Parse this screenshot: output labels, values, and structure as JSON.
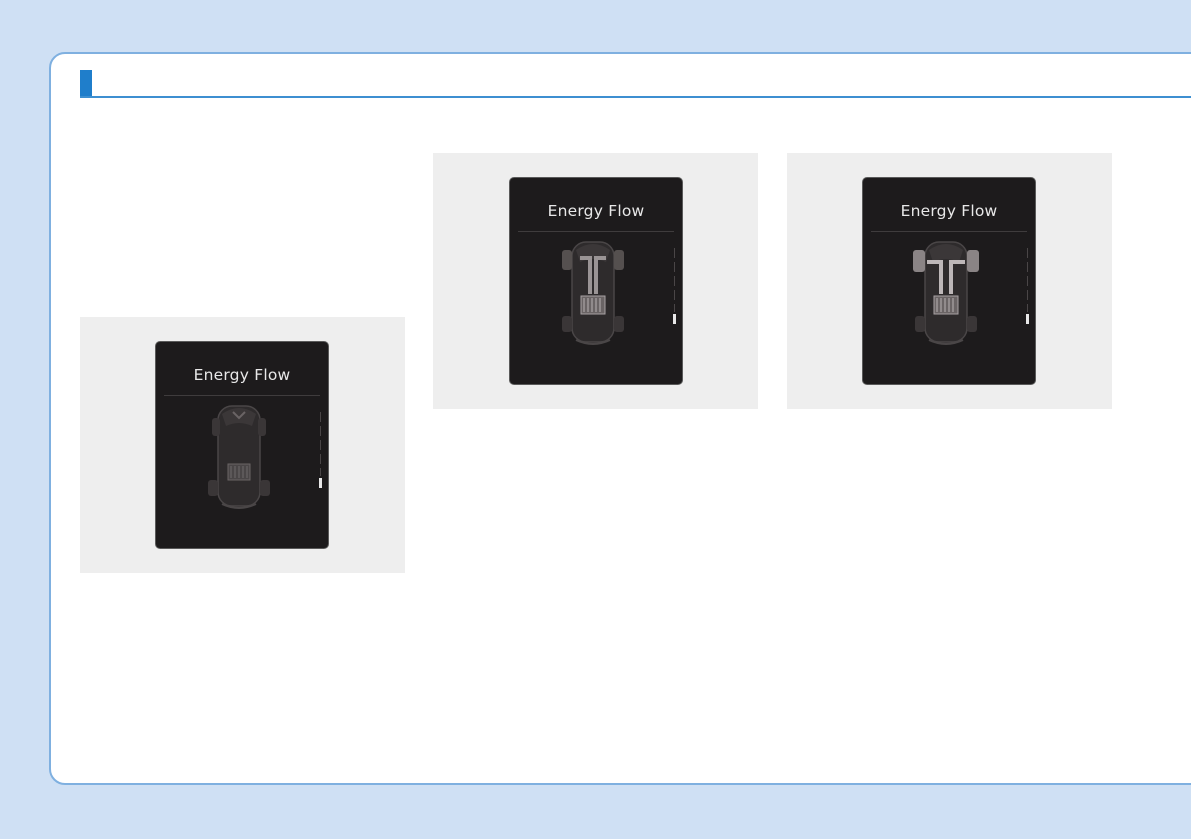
{
  "figures": [
    {
      "title": "Energy Flow",
      "state": "idle"
    },
    {
      "title": "Energy Flow",
      "state": "front-wheels"
    },
    {
      "title": "Energy Flow",
      "state": "all-wheels"
    }
  ],
  "colors": {
    "background": "#cfe0f4",
    "accent": "#1f7ecb",
    "screen": "#1d1b1c"
  }
}
